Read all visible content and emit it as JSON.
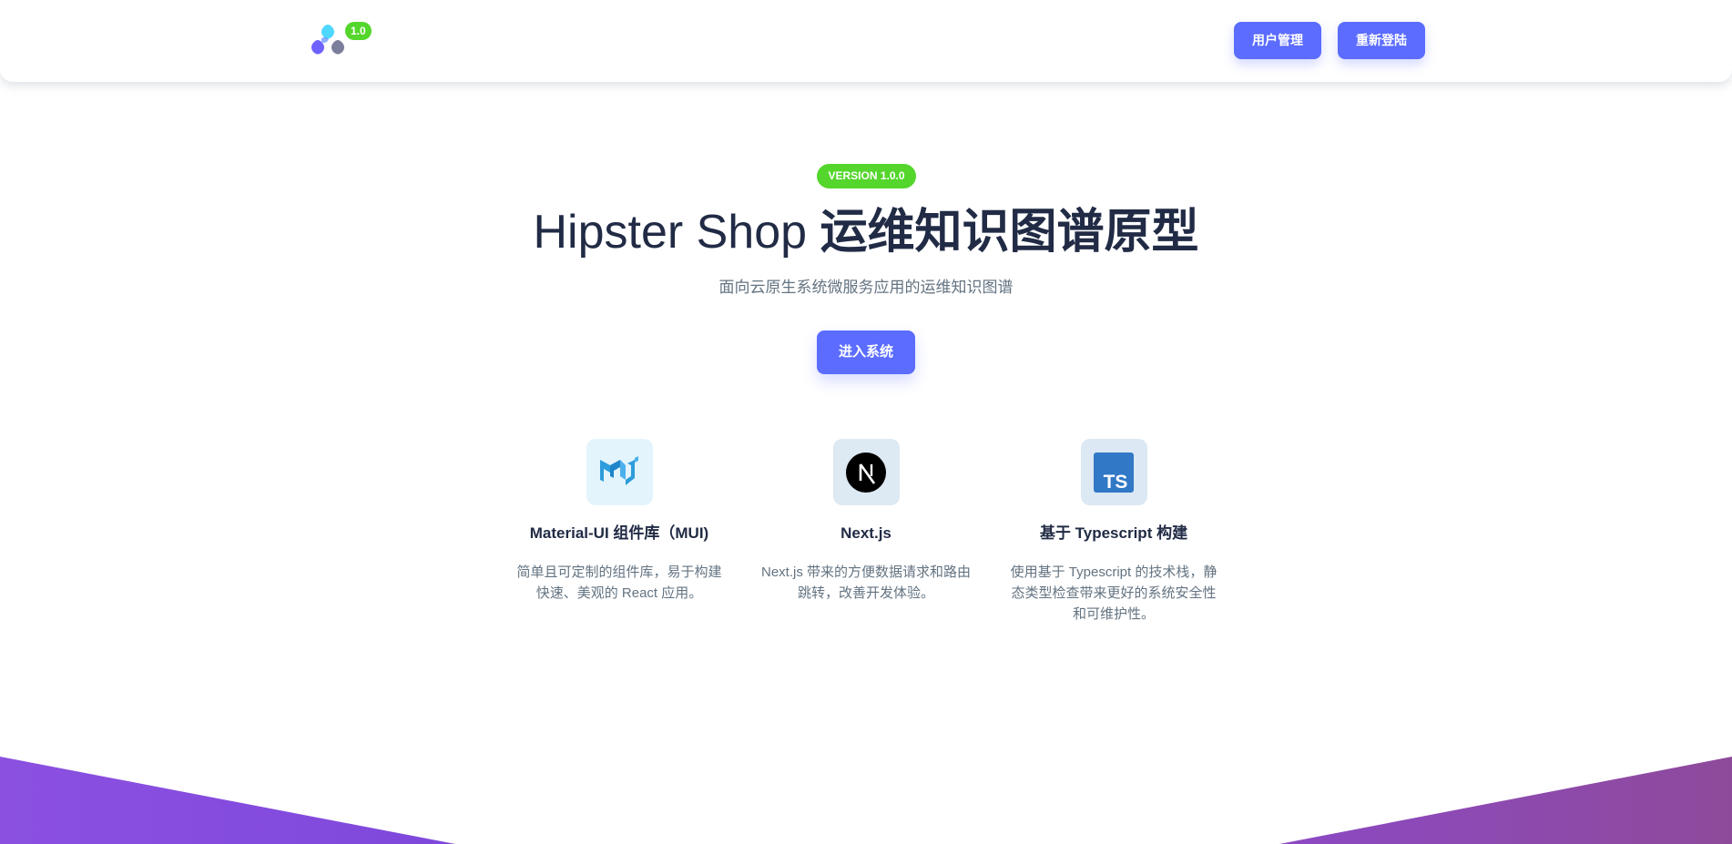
{
  "header": {
    "logo_badge": "1.0",
    "buttons": {
      "user_management": "用户管理",
      "relogin": "重新登陆"
    }
  },
  "hero": {
    "version_badge": "VERSION 1.0.0",
    "title_en": "Hipster Shop ",
    "title_cn": "运维知识图谱原型",
    "subtitle": "面向云原生系统微服务应用的运维知识图谱",
    "enter_button": "进入系统"
  },
  "features": [
    {
      "icon": "mui-logo-icon",
      "title": "Material-UI 组件库（MUI)",
      "description": "简单且可定制的组件库，易于构建快速、美观的 React 应用。"
    },
    {
      "icon": "nextjs-logo-icon",
      "title": "Next.js",
      "description": "Next.js 带来的方便数据请求和路由跳转，改善开发体验。"
    },
    {
      "icon": "typescript-logo-icon",
      "title": "基于 Typescript 构建",
      "description": "使用基于 Typescript 的技术栈，静态类型检查带来更好的系统安全性和可维护性。"
    }
  ],
  "colors": {
    "primary": "#5b6cff",
    "success": "#54d62c",
    "heading": "#212b45",
    "muted": "#637381",
    "gradient_start": "#7f4fe0",
    "gradient_end": "#8e4a9c"
  }
}
